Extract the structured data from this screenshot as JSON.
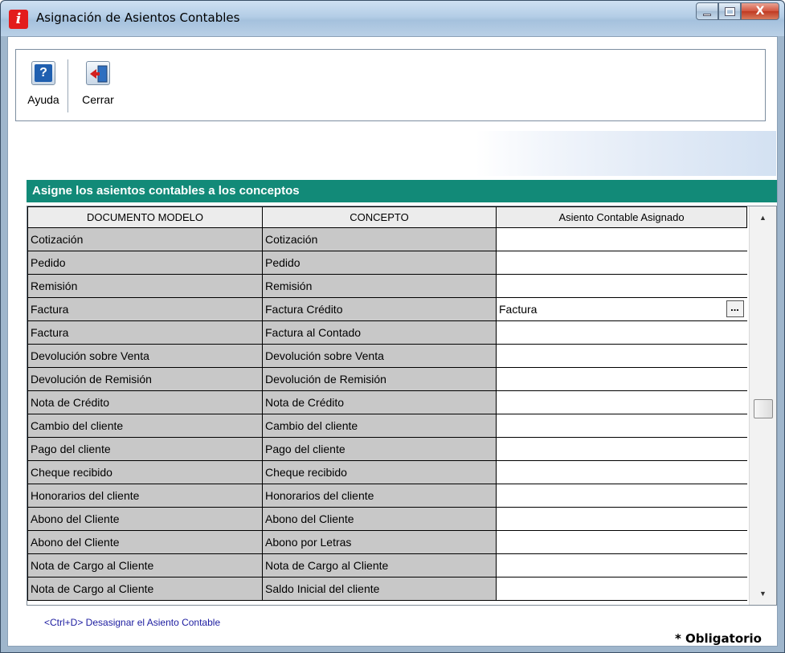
{
  "window": {
    "title": "Asignación de Asientos Contables",
    "app_icon": "i",
    "close_glyph": "X"
  },
  "toolbar": {
    "help_label": "Ayuda",
    "help_glyph": "?",
    "close_label": "Cerrar"
  },
  "section": {
    "header": "Asigne los asientos contables a los conceptos"
  },
  "grid": {
    "columns": [
      "DOCUMENTO MODELO",
      "CONCEPTO",
      "Asiento Contable Asignado"
    ],
    "rows": [
      {
        "documento": "Cotización",
        "concepto": "Cotización",
        "asiento": ""
      },
      {
        "documento": "Pedido",
        "concepto": "Pedido",
        "asiento": ""
      },
      {
        "documento": "Remisión",
        "concepto": "Remisión",
        "asiento": ""
      },
      {
        "documento": "Factura",
        "concepto": "Factura Crédito",
        "asiento": "Factura"
      },
      {
        "documento": "Factura",
        "concepto": "Factura al Contado",
        "asiento": ""
      },
      {
        "documento": "Devolución sobre Venta",
        "concepto": "Devolución sobre Venta",
        "asiento": ""
      },
      {
        "documento": "Devolución de Remisión",
        "concepto": "Devolución de Remisión",
        "asiento": ""
      },
      {
        "documento": "Nota de Crédito",
        "concepto": "Nota de Crédito",
        "asiento": ""
      },
      {
        "documento": "Cambio del cliente",
        "concepto": "Cambio del cliente",
        "asiento": ""
      },
      {
        "documento": "Pago del cliente",
        "concepto": "Pago del cliente",
        "asiento": ""
      },
      {
        "documento": "Cheque recibido",
        "concepto": "Cheque recibido",
        "asiento": ""
      },
      {
        "documento": "Honorarios del cliente",
        "concepto": "Honorarios del cliente",
        "asiento": ""
      },
      {
        "documento": "Abono del Cliente",
        "concepto": "Abono del Cliente",
        "asiento": ""
      },
      {
        "documento": "Abono del Cliente",
        "concepto": "Abono por Letras",
        "asiento": ""
      },
      {
        "documento": "Nota de Cargo al Cliente",
        "concepto": "Nota de Cargo al Cliente",
        "asiento": ""
      },
      {
        "documento": "Nota de Cargo al Cliente",
        "concepto": "Saldo Inicial del cliente",
        "asiento": ""
      }
    ],
    "selected_row": 3,
    "ellipsis_label": "...",
    "scroll_up_glyph": "▲",
    "scroll_down_glyph": "▼"
  },
  "footer": {
    "hint": "<Ctrl+D>  Desasignar el Asiento Contable",
    "required": "* Obligatorio"
  },
  "colors": {
    "section_header_bg": "#128a78",
    "readonly_cell_bg": "#c8c8c8",
    "hint_text": "#1c1ca0"
  }
}
